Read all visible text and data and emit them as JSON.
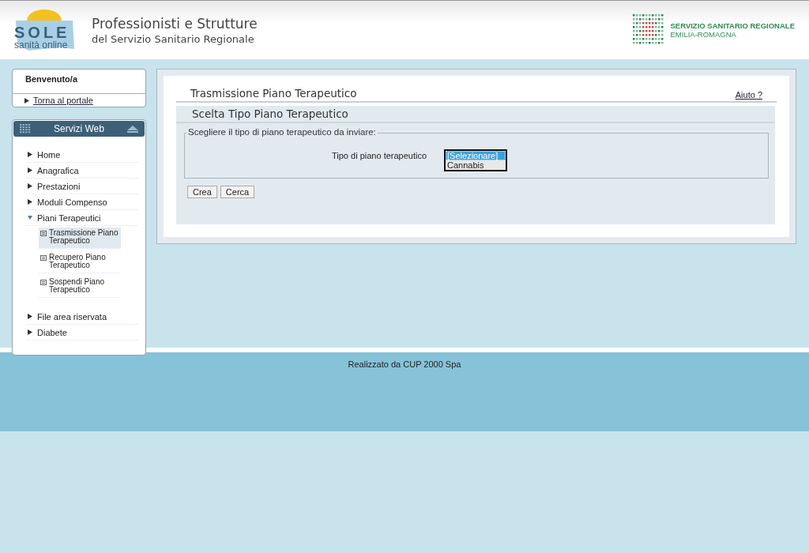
{
  "header": {
    "logo": {
      "name": "SOLE",
      "tagline": "sanità online"
    },
    "title": "Professionisti e Strutture",
    "subtitle": "del Servizio Sanitario Regionale",
    "region": {
      "line1": "SERVIZIO SANITARIO REGIONALE",
      "line2": "EMILIA-ROMAGNA"
    }
  },
  "welcome": {
    "title": "Benvenuto/a",
    "link": "Torna al portale"
  },
  "services": {
    "title": "Servizi Web",
    "items": [
      {
        "label": "Home",
        "expanded": false
      },
      {
        "label": "Anagrafica",
        "expanded": false
      },
      {
        "label": "Prestazioni",
        "expanded": false
      },
      {
        "label": "Moduli Compenso",
        "expanded": false
      },
      {
        "label": "Piani Terapeutici",
        "expanded": true,
        "children": [
          {
            "label": "Trasmissione Piano Terapeutico",
            "selected": true
          },
          {
            "label": "Recupero Piano Terapeutico",
            "selected": false
          },
          {
            "label": "Sospendi Piano Terapeutico",
            "selected": false
          }
        ]
      },
      {
        "label": "File area riservata",
        "expanded": false
      },
      {
        "label": "Diabete",
        "expanded": false
      }
    ]
  },
  "main": {
    "title": "Trasmissione Piano Terapeutico",
    "help": "Aiuto ?",
    "section": "Scelta Tipo Piano Terapeutico",
    "fieldset": "Scegliere il tipo di piano terapeutico da inviare:",
    "field_label": "Tipo di piano terapeutico",
    "options": [
      {
        "label": "[Selezionare]",
        "selected": true
      },
      {
        "label": "Cannabis",
        "selected": false
      }
    ],
    "buttons": [
      "Crea",
      "Cerca"
    ]
  },
  "footer": "Realizzato da CUP 2000 Spa"
}
